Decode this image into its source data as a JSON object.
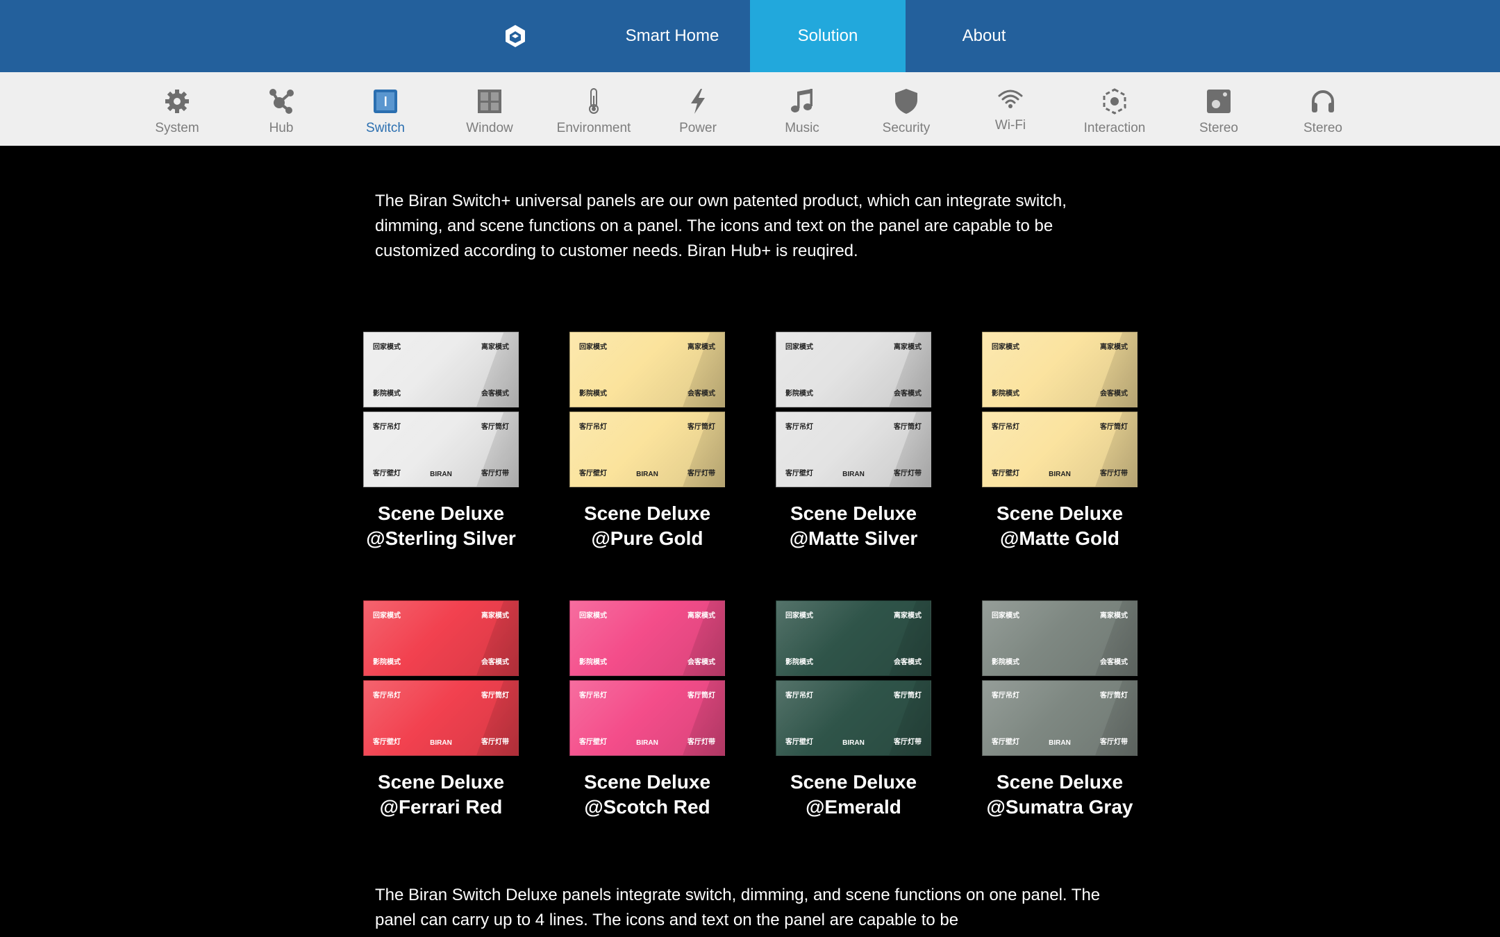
{
  "topnav": {
    "items": [
      {
        "label": "Smart Home"
      },
      {
        "label": "Solution"
      },
      {
        "label": "About"
      }
    ]
  },
  "subnav": {
    "items": [
      {
        "label": "System",
        "icon": "gear-icon"
      },
      {
        "label": "Hub",
        "icon": "hub-icon"
      },
      {
        "label": "Switch",
        "icon": "switch-icon"
      },
      {
        "label": "Window",
        "icon": "window-icon"
      },
      {
        "label": "Environment",
        "icon": "thermometer-icon"
      },
      {
        "label": "Power",
        "icon": "lightning-icon"
      },
      {
        "label": "Music",
        "icon": "music-note-icon"
      },
      {
        "label": "Security",
        "icon": "shield-icon"
      },
      {
        "label": "Wi-Fi",
        "icon": "wifi-icon"
      },
      {
        "label": "Interaction",
        "icon": "interaction-icon"
      },
      {
        "label": "Stereo",
        "icon": "speaker-icon"
      },
      {
        "label": "Stereo",
        "icon": "headphones-icon"
      }
    ],
    "active": "Switch"
  },
  "intro": "The Biran Switch+ universal panels are our own patented product, which can integrate switch, dimming, and scene functions on a panel. The icons and text on the panel are capable to be customized according to customer needs. Biran Hub+ is reuqired.",
  "panel_text": {
    "top_tl": "回家模式",
    "top_tr": "离家模式",
    "top_bl": "影院模式",
    "top_br": "会客模式",
    "bot_tl": "客厅吊灯",
    "bot_tr": "客厅筒灯",
    "bot_bl": "客厅壁灯",
    "bot_br": "客厅灯带",
    "brand": "BIRAN"
  },
  "products": [
    {
      "line1": "Scene Deluxe",
      "line2": "@Sterling Silver",
      "color": "#ececec",
      "text_color": "#222222"
    },
    {
      "line1": "Scene Deluxe",
      "line2": "@Pure Gold",
      "color": "#fbe39c",
      "text_color": "#222222"
    },
    {
      "line1": "Scene Deluxe",
      "line2": "@Matte Silver",
      "color": "#e3e3e3",
      "text_color": "#222222"
    },
    {
      "line1": "Scene Deluxe",
      "line2": "@Matte Gold",
      "color": "#fbe39f",
      "text_color": "#222222"
    },
    {
      "line1": "Scene Deluxe",
      "line2": "@Ferrari Red",
      "color": "#f2414f",
      "text_color": "#ffffff"
    },
    {
      "line1": "Scene Deluxe",
      "line2": "@Scotch Red",
      "color": "#f44d8a",
      "text_color": "#ffffff"
    },
    {
      "line1": "Scene Deluxe",
      "line2": "@Emerald",
      "color": "#2f5449",
      "text_color": "#ffffff"
    },
    {
      "line1": "Scene Deluxe",
      "line2": "@Sumatra Gray",
      "color": "#7e8882",
      "text_color": "#ffffff"
    }
  ],
  "outro": "The Biran Switch Deluxe panels integrate switch, dimming, and scene functions on one panel. The panel can carry up to 4 lines. The icons and text on the panel are capable to be"
}
